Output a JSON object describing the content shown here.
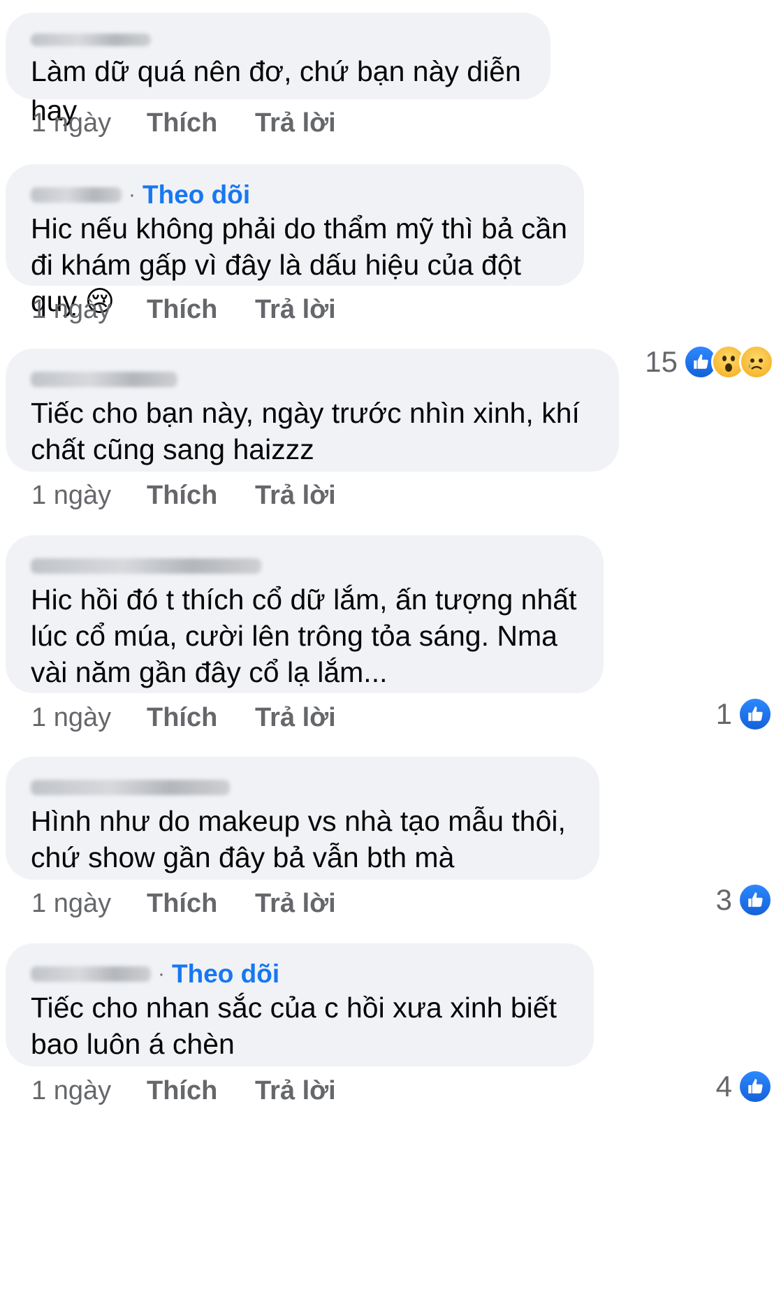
{
  "comments": [
    {
      "author_hint": "Nguyen Le",
      "follow_label": "",
      "text": "Làm dữ quá nên đơ, chứ bạn này diễn hay",
      "time": "1 ngày",
      "like_label": "Thích",
      "reply_label": "Trả lời",
      "reaction_count": "",
      "reactions": []
    },
    {
      "author_hint": "Hehehe",
      "follow_label": "Theo dõi",
      "text": "Hic nếu không phải do thẩm mỹ thì bả cần đi khám gấp vì đây là dấu hiệu của đột quỵ 😢",
      "time": "1 ngày",
      "like_label": "Thích",
      "reply_label": "Trả lời",
      "reaction_count": "15",
      "reactions": [
        "like-icon",
        "wow-icon",
        "sad-icon"
      ]
    },
    {
      "author_hint": "Alala Ha",
      "follow_label": "",
      "text": "Tiếc cho bạn này, ngày trước nhìn xinh, khí chất cũng sang haizzz",
      "time": "1 ngày",
      "like_label": "Thích",
      "reply_label": "Trả lời",
      "reaction_count": "",
      "reactions": []
    },
    {
      "author_hint": "3 chị em tui",
      "follow_label": "",
      "text": "Hic hồi đó t thích cổ dữ lắm, ấn tượng nhất lúc cổ múa, cười lên trông tỏa sáng. Nma vài năm gần đây cổ lạ lắm...",
      "time": "1 ngày",
      "like_label": "Thích",
      "reply_label": "Trả lời",
      "reaction_count": "1",
      "reactions": [
        "like-icon"
      ]
    },
    {
      "author_hint": "Võ Thị Thùy",
      "follow_label": "",
      "text": "Hình như do makeup vs nhà tạo mẫu thôi, chứ show gần đây bả vẫn bth mà",
      "time": "1 ngày",
      "like_label": "Thích",
      "reply_label": "Trả lời",
      "reaction_count": "3",
      "reactions": [
        "like-icon"
      ]
    },
    {
      "author_hint": "Hang Phan",
      "follow_label": "Theo dõi",
      "text": "Tiếc cho nhan sắc của c hồi xưa xinh biết bao luôn á chèn",
      "time": "1 ngày",
      "like_label": "Thích",
      "reply_label": "Trả lời",
      "reaction_count": "4",
      "reactions": [
        "like-icon"
      ]
    }
  ],
  "colors": {
    "bubble": "#f0f2f5",
    "link": "#1877f2",
    "meta": "#65676b",
    "text": "#050505"
  }
}
